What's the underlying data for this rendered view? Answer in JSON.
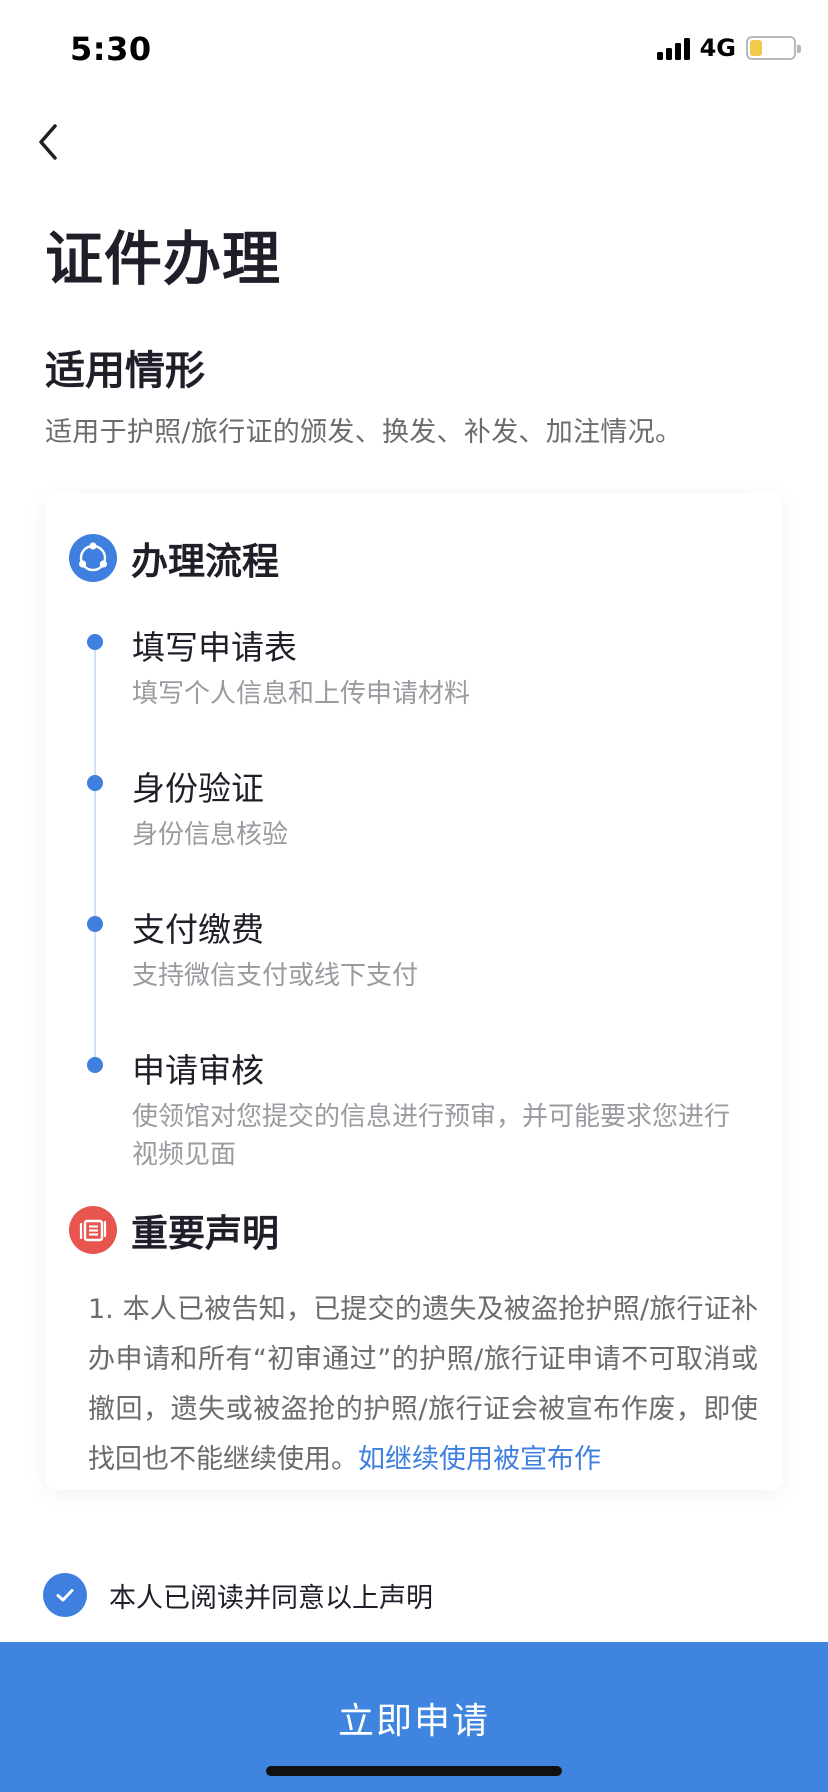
{
  "status_bar": {
    "time": "5:30",
    "network": "4G"
  },
  "page": {
    "title": "证件办理"
  },
  "scenario": {
    "title": "适用情形",
    "description": "适用于护照/旅行证的颁发、换发、补发、加注情况。"
  },
  "process": {
    "title": "办理流程",
    "steps": [
      {
        "title": "填写申请表",
        "desc": "填写个人信息和上传申请材料"
      },
      {
        "title": "身份验证",
        "desc": "身份信息核验"
      },
      {
        "title": "支付缴费",
        "desc": "支持微信支付或线下支付"
      },
      {
        "title": "申请审核",
        "desc": "使领馆对您提交的信息进行预审，并可能要求您进行视频见面"
      }
    ]
  },
  "declaration": {
    "title": "重要声明",
    "text": "1. 本人已被告知，已提交的遗失及被盗抢护照/旅行证补办申请和所有“初审通过”的护照/旅行证申请不可取消或撤回，遗失或被盗抢的护照/旅行证会被宣布作废，即使找回也不能继续使用。",
    "link_text": "如继续使用被宣布作"
  },
  "agreement": {
    "label": "本人已阅读并同意以上声明",
    "checked": true
  },
  "apply_button": {
    "label": "立即申请"
  },
  "colors": {
    "primary": "#3e7fe0",
    "button": "#3f85df",
    "warning": "#e8554e"
  }
}
